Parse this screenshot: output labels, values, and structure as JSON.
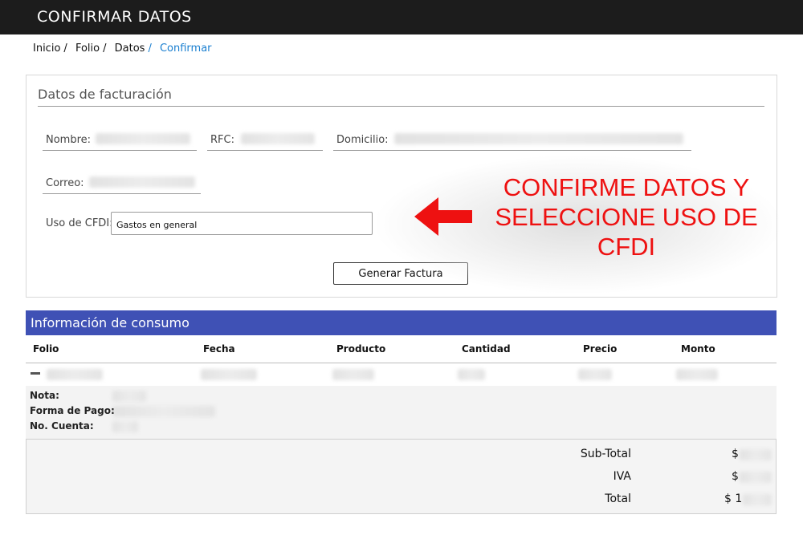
{
  "header": {
    "title": "CONFIRMAR DATOS"
  },
  "breadcrumb": {
    "items": [
      "Inicio",
      "Folio",
      "Datos"
    ],
    "separator": "/",
    "current": "Confirmar"
  },
  "billing": {
    "title": "Datos de facturación",
    "fields": {
      "nombre_label": "Nombre:",
      "rfc_label": "RFC:",
      "domicilio_label": "Domicilio:",
      "correo_label": "Correo:"
    },
    "cfdi": {
      "label": "Uso de CFDI:",
      "selected": "Gastos en general"
    },
    "button_label": "Generar Factura"
  },
  "callout": {
    "lines": [
      "CONFIRME DATOS Y",
      "SELECCIONE USO DE",
      "CFDI"
    ],
    "color": "#ee1111",
    "icon": "arrow-left-icon"
  },
  "consumption": {
    "title": "Información de consumo",
    "columns": [
      "Folio",
      "Fecha",
      "Producto",
      "Cantidad",
      "Precio",
      "Monto"
    ],
    "details": {
      "nota_label": "Nota:",
      "forma_pago_label": "Forma de Pago:",
      "cuenta_label": "No. Cuenta:"
    },
    "totals": {
      "subtotal_label": "Sub-Total",
      "iva_label": "IVA",
      "total_label": "Total",
      "currency": "$",
      "total_prefix": "$ 1"
    }
  },
  "colors": {
    "header_bg": "#1c1c1c",
    "section_bg": "#3f51b5",
    "link": "#1a7fd0"
  }
}
